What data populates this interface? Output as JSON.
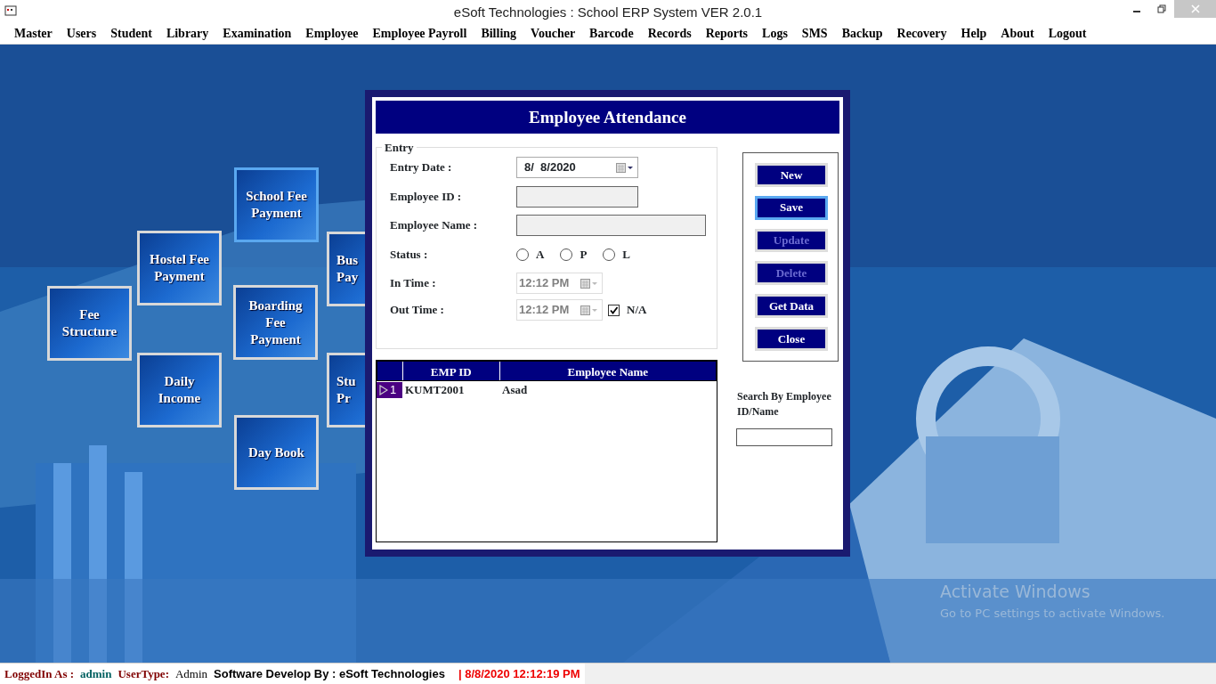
{
  "window": {
    "title": "eSoft Technologies : School ERP System VER 2.0.1"
  },
  "menu": [
    {
      "label": "Master"
    },
    {
      "label": "Users"
    },
    {
      "label": "Student"
    },
    {
      "label": "Library"
    },
    {
      "label": "Examination"
    },
    {
      "label": "Employee"
    },
    {
      "label": "Employee Payroll"
    },
    {
      "label": "Billing"
    },
    {
      "label": "Voucher"
    },
    {
      "label": "Barcode"
    },
    {
      "label": "Records"
    },
    {
      "label": "Reports"
    },
    {
      "label": "Logs"
    },
    {
      "label": "SMS"
    },
    {
      "label": "Backup"
    },
    {
      "label": "Recovery"
    },
    {
      "label": "Help"
    },
    {
      "label": "About"
    },
    {
      "label": "Logout"
    }
  ],
  "tiles": [
    {
      "label": "Fee Structure",
      "kind": "full",
      "selected": false
    },
    {
      "label": "Hostel Fee Payment",
      "kind": "full",
      "selected": false
    },
    {
      "label": "School Fee Payment",
      "kind": "full",
      "selected": true
    },
    {
      "label": "Boarding Fee Payment",
      "kind": "full",
      "selected": false
    },
    {
      "label": "Daily Income",
      "kind": "full",
      "selected": false
    },
    {
      "label": "Day Book",
      "kind": "full",
      "selected": false
    },
    {
      "label": "Bus Pay",
      "kind": "cut",
      "selected": false
    },
    {
      "label": "Stu Pr",
      "kind": "cut",
      "selected": false
    }
  ],
  "dialog": {
    "title": "Employee Attendance",
    "entry": {
      "legend": "Entry",
      "entry_date": {
        "label": "Entry Date :",
        "value": "8/  8/2020"
      },
      "employee_id": {
        "label": "Employee ID :"
      },
      "employee_name": {
        "label": "Employee Name :"
      },
      "status": {
        "label": "Status :",
        "options": [
          {
            "label": "A",
            "selected": false
          },
          {
            "label": "P",
            "selected": false
          },
          {
            "label": "L",
            "selected": false
          }
        ]
      },
      "in_time": {
        "label": "In Time :",
        "value": "12:12 PM",
        "disabled": true
      },
      "out_time": {
        "label": "Out Time :",
        "value": "12:12 PM",
        "disabled": true
      },
      "na": {
        "label": "N/A",
        "checked": true
      }
    },
    "buttons": [
      {
        "label": "New",
        "disabled": false,
        "focused": false
      },
      {
        "label": "Save",
        "disabled": false,
        "focused": true
      },
      {
        "label": "Update",
        "disabled": true,
        "focused": false
      },
      {
        "label": "Delete",
        "disabled": true,
        "focused": false
      },
      {
        "label": "Get Data",
        "disabled": false,
        "focused": false
      },
      {
        "label": "Close",
        "disabled": false,
        "focused": false
      }
    ],
    "grid": {
      "columns": [
        "EMP ID",
        "Employee Name"
      ],
      "rows": [
        {
          "row_number": "1",
          "selected": true,
          "cells": [
            "KUMT2001",
            "Asad"
          ]
        }
      ]
    },
    "search": {
      "label": "Search By Employee ID/Name"
    }
  },
  "os_notice": {
    "title": "Activate Windows",
    "text": "Go to PC settings to activate Windows."
  },
  "status_bar": [
    {
      "kind": "label",
      "text": "LoggedIn As :"
    },
    {
      "kind": "value",
      "text": "admin"
    },
    {
      "kind": "label",
      "text": "UserType:"
    },
    {
      "kind": "plain",
      "text": "Admin"
    },
    {
      "kind": "credit",
      "text": "Software Develop By : eSoft Technologies"
    },
    {
      "kind": "time",
      "text": "| 8/8/2020 12:12:19 PM"
    }
  ]
}
